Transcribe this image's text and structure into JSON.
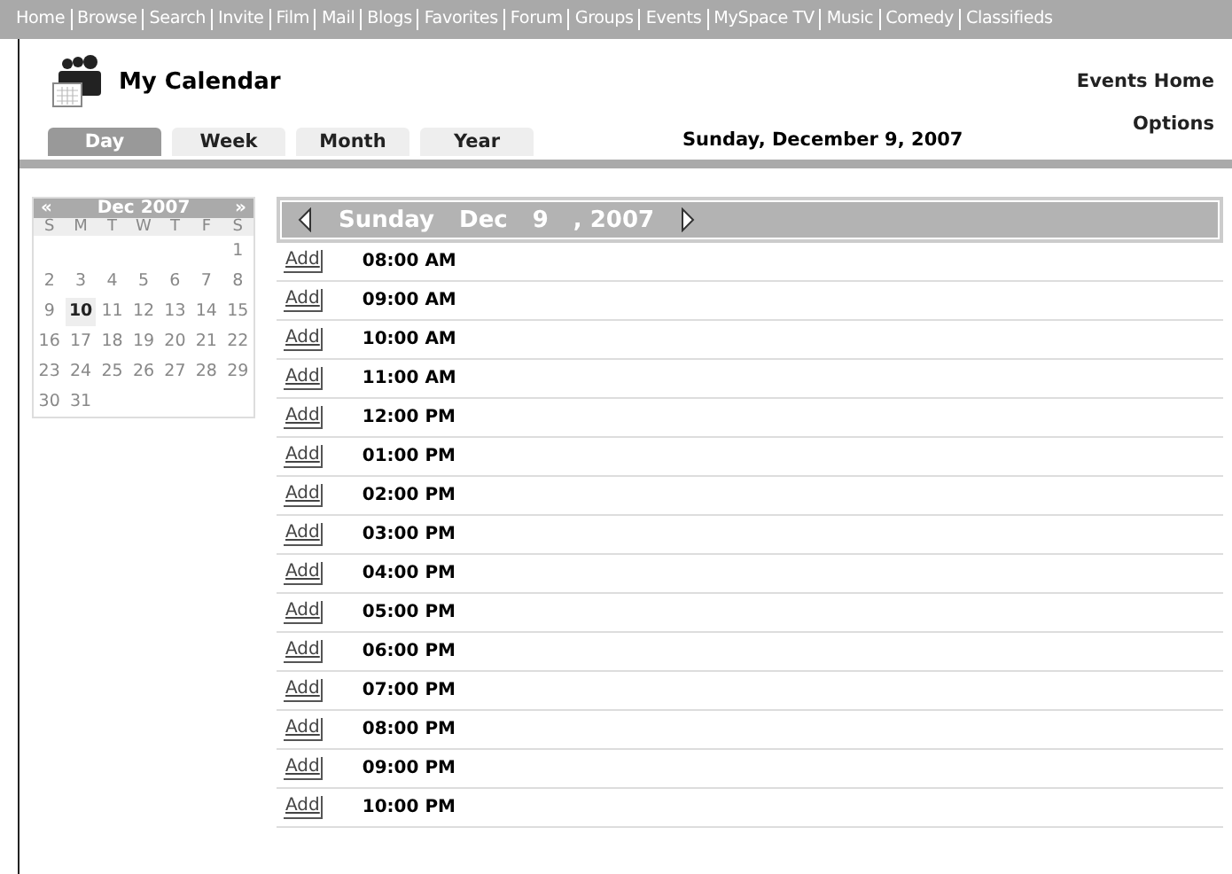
{
  "nav_links": [
    "Home",
    "Browse",
    "Search",
    "Invite",
    "Film",
    "Mail",
    "Blogs",
    "Favorites",
    "Forum",
    "Groups",
    "Events",
    "MySpace TV",
    "Music",
    "Comedy",
    "Classifieds"
  ],
  "title": "My Calendar",
  "events_home": "Events Home",
  "options": "Options",
  "tabs": [
    {
      "label": "Day",
      "selected": true
    },
    {
      "label": "Week",
      "selected": false
    },
    {
      "label": "Month",
      "selected": false
    },
    {
      "label": "Year",
      "selected": false
    }
  ],
  "current_date": "Sunday, December 9, 2007",
  "mini_calendar": {
    "prev": "«",
    "month": "Dec 2007",
    "next": "»",
    "weekdays": [
      "S",
      "M",
      "T",
      "W",
      "T",
      "F",
      "S"
    ],
    "weeks": [
      [
        {
          "day": "1",
          "selected": false
        }
      ],
      [
        {
          "day": "2",
          "selected": false
        },
        {
          "day": "3",
          "selected": false
        },
        {
          "day": "4",
          "selected": false
        },
        {
          "day": "5",
          "selected": false
        },
        {
          "day": "6",
          "selected": false
        },
        {
          "day": "7",
          "selected": false
        },
        {
          "day": "8",
          "selected": false
        }
      ],
      [
        {
          "day": "9",
          "selected": false
        },
        {
          "day": "10",
          "selected": true
        },
        {
          "day": "11",
          "selected": false
        },
        {
          "day": "12",
          "selected": false
        },
        {
          "day": "13",
          "selected": false
        },
        {
          "day": "14",
          "selected": false
        },
        {
          "day": "15",
          "selected": false
        }
      ],
      [
        {
          "day": "16",
          "selected": false
        },
        {
          "day": "17",
          "selected": false
        },
        {
          "day": "18",
          "selected": false
        },
        {
          "day": "19",
          "selected": false
        },
        {
          "day": "20",
          "selected": false
        },
        {
          "day": "21",
          "selected": false
        },
        {
          "day": "22",
          "selected": false
        }
      ],
      [
        {
          "day": "23",
          "selected": false
        },
        {
          "day": "24",
          "selected": false
        },
        {
          "day": "25",
          "selected": false
        },
        {
          "day": "26",
          "selected": false
        },
        {
          "day": "27",
          "selected": false
        },
        {
          "day": "28",
          "selected": false
        },
        {
          "day": "29",
          "selected": false
        }
      ],
      [
        {
          "day": "30",
          "selected": false
        },
        {
          "day": "31",
          "selected": false
        }
      ]
    ]
  },
  "day_header": {
    "weekday": "Sunday",
    "month": "Dec",
    "day": "9",
    "year": ", 2007"
  },
  "slots": [
    {
      "add": "Add",
      "time": "08:00 AM"
    },
    {
      "add": "Add",
      "time": "09:00 AM"
    },
    {
      "add": "Add",
      "time": "10:00 AM"
    },
    {
      "add": "Add",
      "time": "11:00 AM"
    },
    {
      "add": "Add",
      "time": "12:00 PM"
    },
    {
      "add": "Add",
      "time": "01:00 PM"
    },
    {
      "add": "Add",
      "time": "02:00 PM"
    },
    {
      "add": "Add",
      "time": "03:00 PM"
    },
    {
      "add": "Add",
      "time": "04:00 PM"
    },
    {
      "add": "Add",
      "time": "05:00 PM"
    },
    {
      "add": "Add",
      "time": "06:00 PM"
    },
    {
      "add": "Add",
      "time": "07:00 PM"
    },
    {
      "add": "Add",
      "time": "08:00 PM"
    },
    {
      "add": "Add",
      "time": "09:00 PM"
    },
    {
      "add": "Add",
      "time": "10:00 PM"
    }
  ]
}
